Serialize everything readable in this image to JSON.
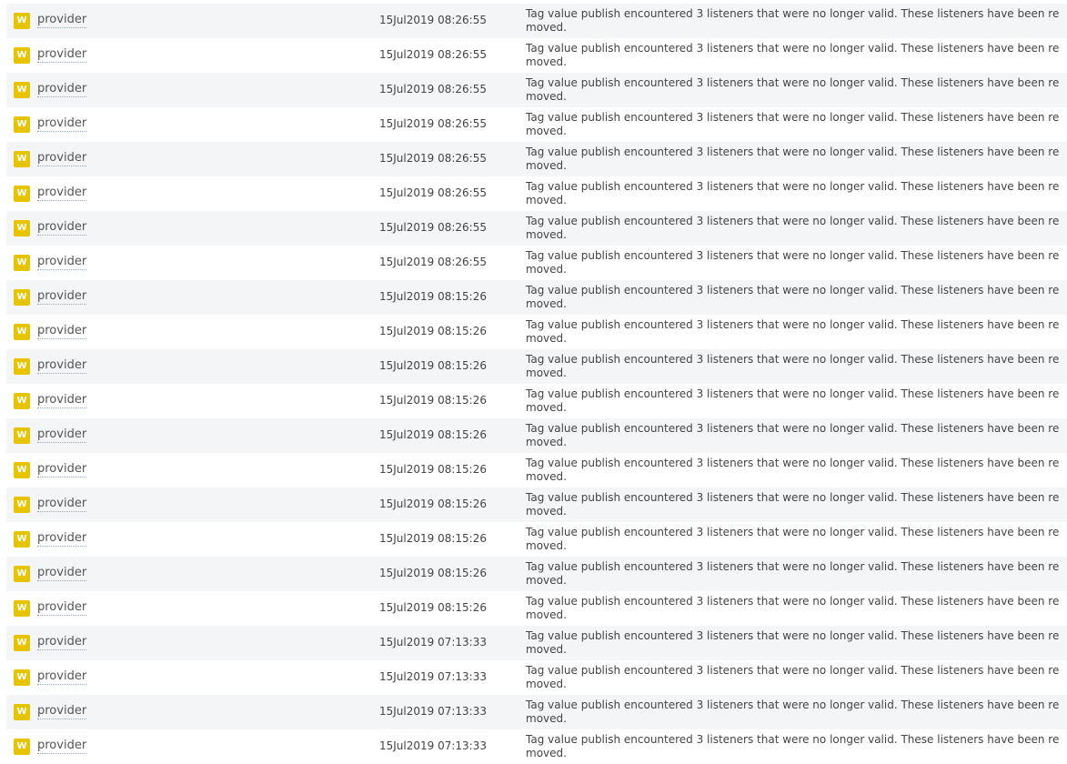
{
  "colors": {
    "warn_badge": "#e8c400",
    "row_alt": "#f3f5f7"
  },
  "log": {
    "rows": [
      {
        "level": "W",
        "logger": "provider",
        "timestamp": "15Jul2019 08:26:55",
        "message": "Tag value publish encountered 3 listeners that were no longer valid. These listeners have been removed."
      },
      {
        "level": "W",
        "logger": "provider",
        "timestamp": "15Jul2019 08:26:55",
        "message": "Tag value publish encountered 3 listeners that were no longer valid. These listeners have been removed."
      },
      {
        "level": "W",
        "logger": "provider",
        "timestamp": "15Jul2019 08:26:55",
        "message": "Tag value publish encountered 3 listeners that were no longer valid. These listeners have been removed."
      },
      {
        "level": "W",
        "logger": "provider",
        "timestamp": "15Jul2019 08:26:55",
        "message": "Tag value publish encountered 3 listeners that were no longer valid. These listeners have been removed."
      },
      {
        "level": "W",
        "logger": "provider",
        "timestamp": "15Jul2019 08:26:55",
        "message": "Tag value publish encountered 3 listeners that were no longer valid. These listeners have been removed."
      },
      {
        "level": "W",
        "logger": "provider",
        "timestamp": "15Jul2019 08:26:55",
        "message": "Tag value publish encountered 3 listeners that were no longer valid. These listeners have been removed."
      },
      {
        "level": "W",
        "logger": "provider",
        "timestamp": "15Jul2019 08:26:55",
        "message": "Tag value publish encountered 3 listeners that were no longer valid. These listeners have been removed."
      },
      {
        "level": "W",
        "logger": "provider",
        "timestamp": "15Jul2019 08:26:55",
        "message": "Tag value publish encountered 3 listeners that were no longer valid. These listeners have been removed."
      },
      {
        "level": "W",
        "logger": "provider",
        "timestamp": "15Jul2019 08:15:26",
        "message": "Tag value publish encountered 3 listeners that were no longer valid. These listeners have been removed."
      },
      {
        "level": "W",
        "logger": "provider",
        "timestamp": "15Jul2019 08:15:26",
        "message": "Tag value publish encountered 3 listeners that were no longer valid. These listeners have been removed."
      },
      {
        "level": "W",
        "logger": "provider",
        "timestamp": "15Jul2019 08:15:26",
        "message": "Tag value publish encountered 3 listeners that were no longer valid. These listeners have been removed."
      },
      {
        "level": "W",
        "logger": "provider",
        "timestamp": "15Jul2019 08:15:26",
        "message": "Tag value publish encountered 3 listeners that were no longer valid. These listeners have been removed."
      },
      {
        "level": "W",
        "logger": "provider",
        "timestamp": "15Jul2019 08:15:26",
        "message": "Tag value publish encountered 3 listeners that were no longer valid. These listeners have been removed."
      },
      {
        "level": "W",
        "logger": "provider",
        "timestamp": "15Jul2019 08:15:26",
        "message": "Tag value publish encountered 3 listeners that were no longer valid. These listeners have been removed."
      },
      {
        "level": "W",
        "logger": "provider",
        "timestamp": "15Jul2019 08:15:26",
        "message": "Tag value publish encountered 3 listeners that were no longer valid. These listeners have been removed."
      },
      {
        "level": "W",
        "logger": "provider",
        "timestamp": "15Jul2019 08:15:26",
        "message": "Tag value publish encountered 3 listeners that were no longer valid. These listeners have been removed."
      },
      {
        "level": "W",
        "logger": "provider",
        "timestamp": "15Jul2019 08:15:26",
        "message": "Tag value publish encountered 3 listeners that were no longer valid. These listeners have been removed."
      },
      {
        "level": "W",
        "logger": "provider",
        "timestamp": "15Jul2019 08:15:26",
        "message": "Tag value publish encountered 3 listeners that were no longer valid. These listeners have been removed."
      },
      {
        "level": "W",
        "logger": "provider",
        "timestamp": "15Jul2019 07:13:33",
        "message": "Tag value publish encountered 3 listeners that were no longer valid. These listeners have been removed."
      },
      {
        "level": "W",
        "logger": "provider",
        "timestamp": "15Jul2019 07:13:33",
        "message": "Tag value publish encountered 3 listeners that were no longer valid. These listeners have been removed."
      },
      {
        "level": "W",
        "logger": "provider",
        "timestamp": "15Jul2019 07:13:33",
        "message": "Tag value publish encountered 3 listeners that were no longer valid. These listeners have been removed."
      },
      {
        "level": "W",
        "logger": "provider",
        "timestamp": "15Jul2019 07:13:33",
        "message": "Tag value publish encountered 3 listeners that were no longer valid. These listeners have been removed."
      }
    ]
  }
}
